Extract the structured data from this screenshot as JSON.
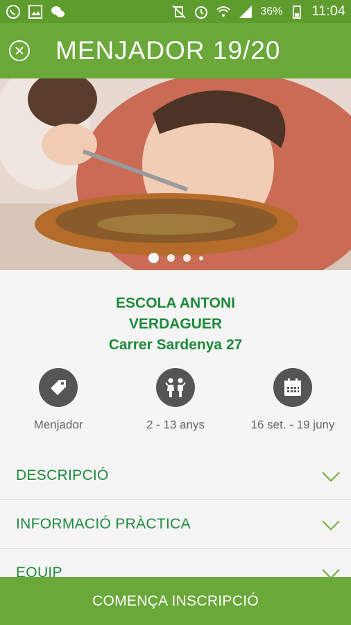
{
  "status_bar": {
    "battery": "36%",
    "time": "11:04",
    "icons": [
      "whatsapp-icon",
      "image-icon",
      "wechat-icon",
      "mute-icon",
      "alarm-icon",
      "wifi-icon",
      "signal-icon",
      "battery-icon"
    ]
  },
  "app_bar": {
    "title": "MENJADOR 19/20",
    "close_icon": "close-circle-icon"
  },
  "hero": {
    "description_icon": "child-eating-photo",
    "carousel_dots": 4,
    "active_index": 0
  },
  "school": {
    "name": "ESCOLA ANTONI VERDAGUER",
    "address": "Carrer  Sardenya 27"
  },
  "features": [
    {
      "icon": "tag-icon",
      "label": "Menjador"
    },
    {
      "icon": "children-icon",
      "label": "2 - 13 anys"
    },
    {
      "icon": "calendar-icon",
      "label": "16 set. - 19 juny"
    }
  ],
  "accordion": [
    {
      "label": "DESCRIPCIÓ"
    },
    {
      "label": "INFORMACIÓ PRÀCTICA"
    },
    {
      "label": "EQUIP"
    }
  ],
  "cta": {
    "label": "COMENÇA INSCRIPCIÓ"
  },
  "colors": {
    "primary": "#6aa83a",
    "status_bar": "#5e9c2e",
    "accent_text": "#1e8a3a",
    "icon_circle": "#555555"
  }
}
